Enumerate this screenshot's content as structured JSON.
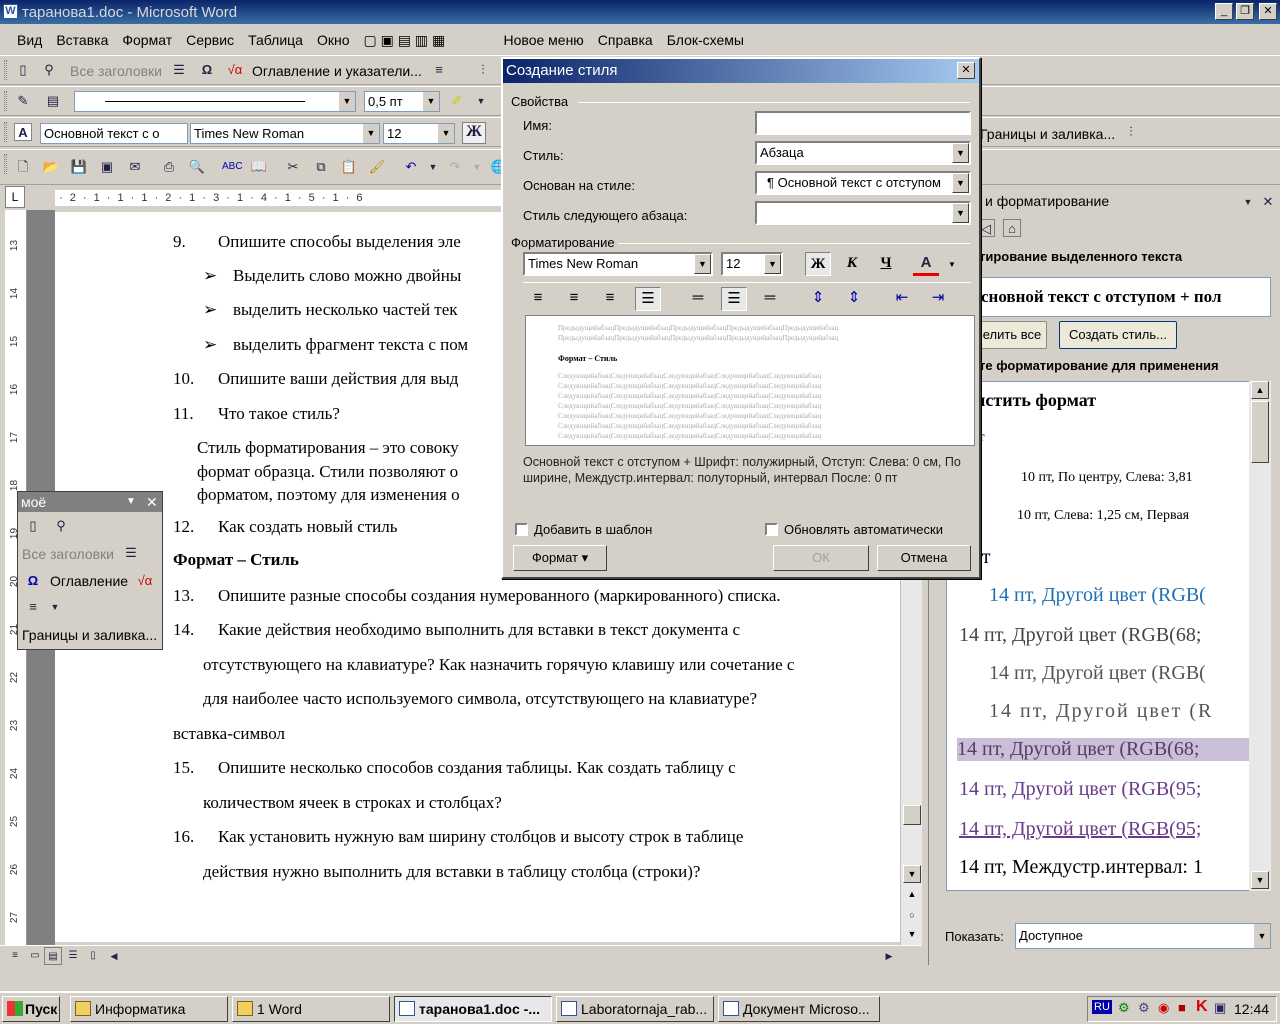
{
  "window": {
    "title": "таранова1.doc - Microsoft Word",
    "min": "_",
    "max": "❐",
    "close": "✕"
  },
  "menu": [
    "Вид",
    "Вставка",
    "Формат",
    "Сервис",
    "Таблица",
    "Окно",
    "Новое меню",
    "Справка",
    "Блок-схемы"
  ],
  "toolbar2": {
    "headings": "Все заголовки",
    "toc": "Оглавление и указатели...",
    "borders": "Границы и заливка..."
  },
  "toolbar3": {
    "line_weight": "0,5 пт"
  },
  "toolbar4": {
    "style": "Основной текст с о",
    "font": "Times New Roman",
    "size": "12",
    "bold": "Ж"
  },
  "ruler": {
    "text": "· 2 · 1 · 1 · 1 · 2 · 1 · 3 · 1 · 4 · 1 · 5 · 1 · 6"
  },
  "vruler": [
    "13",
    "14",
    "15",
    "16",
    "17",
    "18",
    "19",
    "20",
    "21",
    "22",
    "23",
    "24",
    "25",
    "26",
    "27"
  ],
  "document": {
    "lines": [
      {
        "num": "9.",
        "text": "Опишите способы выделения эле"
      },
      {
        "bullet": "➢",
        "text": "Выделить слово можно двойны"
      },
      {
        "bullet": "➢",
        "text": "выделить несколько частей тек"
      },
      {
        "bullet": "➢",
        "text": "выделить фрагмент текста с пом"
      },
      {
        "num": "10.",
        "text": "Опишите ваши действия для выд"
      },
      {
        "num": "11.",
        "text": "Что такое стиль?"
      },
      {
        "text": "Стиль форматирования – это совоку"
      },
      {
        "text": "формат образца. Стили позволяют о"
      },
      {
        "text": "форматом, поэтому для изменения о"
      },
      {
        "num": "12.",
        "text": "Как создать новый стиль"
      },
      {
        "text": "Формат – Стиль",
        "bold": true
      },
      {
        "num": "13.",
        "text": "Опишите разные способы создания нумерованного (маркированного) списка."
      },
      {
        "num": "14.",
        "text": "Какие  действия  необходимо  выполнить  для  вставки  в  текст  документа  с"
      },
      {
        "text": "отсутствующего на клавиатуре? Как назначить горячую клавишу или сочетание с"
      },
      {
        "text": "для наиболее часто используемого символа, отсутствующего на клавиатуре?"
      },
      {
        "text": "вставка-символ"
      },
      {
        "num": "15.",
        "text": "Опишите  несколько  способов  создания  таблицы.  Как  создать  таблицу  с"
      },
      {
        "text": "количеством ячеек в строках и столбцах?"
      },
      {
        "num": "16.",
        "text": "Как  установить  нужную  вам  ширину  столбцов  и  высоту  строк  в  таблице"
      },
      {
        "text": "действия нужно выполнить для вставки в таблицу столбца (строки)?"
      }
    ]
  },
  "taskpane": {
    "title": "и форматирование",
    "selected_label": "тирование выделенного текста",
    "selected_value": "сновной текст с отступом + пол",
    "select_all": "елить все",
    "create_style": "Создать стиль...",
    "apply_label": "те форматирование для применения",
    "items": [
      "истить формат",
      "пт",
      "10 пт, По центру, Слева:  3,81",
      "10 пт, Слева:  1,25 см, Первая",
      "пт",
      "14 пт, Другой цвет (RGB(",
      "14 пт, Другой цвет (RGB(68;",
      "14 пт, Другой цвет (RGB(",
      "14 пт, Другой цвет (R",
      "14 пт, Другой цвет (RGB(68;",
      "14 пт, Другой цвет (RGB(95;",
      "14 пт, Другой цвет (RGB(95;",
      "14 пт, Междустр.интервал:  1"
    ],
    "show_label": "Показать:",
    "show_value": "Доступное"
  },
  "moe_toolbar": {
    "title": "моё",
    "headings": "Все заголовки",
    "toc": "Оглавление",
    "borders": "Границы и заливка..."
  },
  "dialog": {
    "title": "Создание стиля",
    "props_group": "Свойства",
    "name_label": "Имя:",
    "name_value": "",
    "style_label": "Стиль:",
    "style_value": "Абзаца",
    "based_label": "Основан на стиле:",
    "based_value": "¶ Основной текст с отступом",
    "next_label": "Стиль следующего абзаца:",
    "next_value": "",
    "format_group": "Форматирование",
    "font_value": "Times New Roman",
    "size_value": "12",
    "bold": "Ж",
    "italic": "К",
    "underline": "Ч",
    "font_color": "A",
    "preview_prev": "ПредыдущийабзацПредыдущийабзацПредыдущийабзацПредыдущийабзацПредыдущийабзац",
    "preview_cur": "Формат – Стиль",
    "preview_next": "СледующийабзацСледующийабзацСледующийабзацСледующийабзацСледующийабзац",
    "description": "Основной текст с отступом + Шрифт: полужирный, Отступ: Слева:   0 см, По ширине, Междустр.интервал:  полуторный, интервал После:  0 пт",
    "add_template": "Добавить в шаблон",
    "auto_update": "Обновлять автоматически",
    "format_btn": "Формат ▾",
    "ok": "ОК",
    "cancel": "Отмена"
  },
  "taskbar": {
    "start": "Пуск",
    "tasks": [
      "Информатика",
      "1 Word",
      "таранова1.doc -...",
      "Laboratornaja_rab...",
      "Документ Microso..."
    ],
    "lang": "RU",
    "time": "12:44"
  }
}
